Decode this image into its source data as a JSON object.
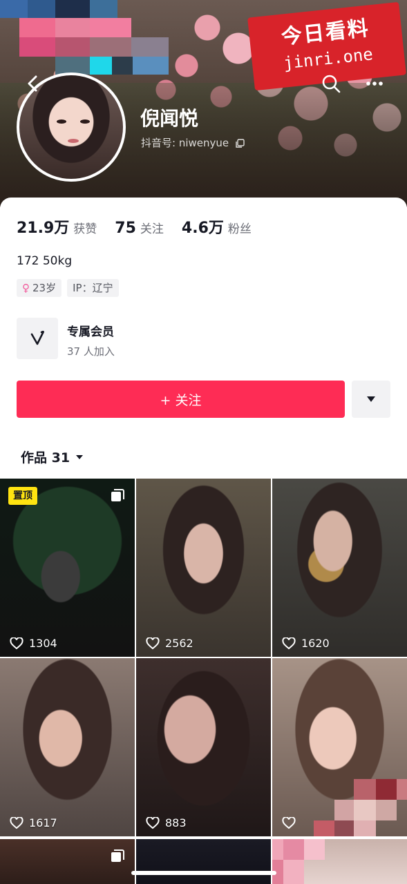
{
  "watermark": {
    "line1": "今日看料",
    "line2": "jinri.one"
  },
  "header": {
    "nickname": "倪闻悦",
    "douyin_id": "抖音号: niwenyue"
  },
  "stats": [
    {
      "value": "21.9万",
      "label": "获赞"
    },
    {
      "value": "75",
      "label": "关注"
    },
    {
      "value": "4.6万",
      "label": "粉丝"
    }
  ],
  "bio": "172 50kg",
  "tags": {
    "age": "23岁",
    "ip": "IP：辽宁",
    "sex_symbol": "♀"
  },
  "member": {
    "title": "专属会员",
    "subtitle": "37 人加入"
  },
  "actions": {
    "follow_label": "+ 关注"
  },
  "works_tab": {
    "label": "作品 31"
  },
  "videos": [
    {
      "likes": "1304",
      "pinned_label": "置顶"
    },
    {
      "likes": "2562"
    },
    {
      "likes": "1620"
    },
    {
      "likes": "1617"
    },
    {
      "likes": "883"
    },
    {
      "likes": ""
    }
  ],
  "colors": {
    "accent": "#fe2c55",
    "pin_badge": "#ffe411",
    "watermark_bg": "#d8232a"
  }
}
